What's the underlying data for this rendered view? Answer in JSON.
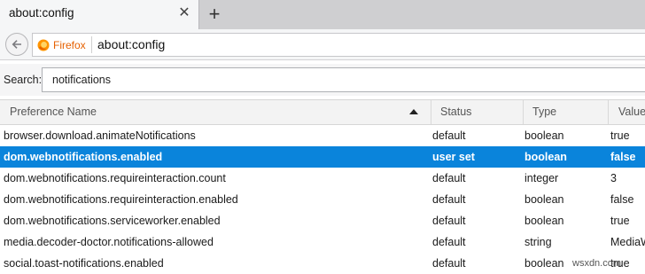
{
  "tab": {
    "title": "about:config",
    "close_glyph": "✕",
    "new_tab_glyph": "+"
  },
  "navbar": {
    "back_icon": "back-arrow-icon",
    "identity_label": "Firefox",
    "url": "about:config"
  },
  "search": {
    "label": "Search:",
    "value": "notifications"
  },
  "table": {
    "columns": [
      "Preference Name",
      "Status",
      "Type",
      "Value"
    ],
    "sort_column": "Preference Name",
    "sort_direction": "ascending",
    "rows": [
      {
        "name": "browser.download.animateNotifications",
        "status": "default",
        "type": "boolean",
        "value": "true",
        "selected": false
      },
      {
        "name": "dom.webnotifications.enabled",
        "status": "user set",
        "type": "boolean",
        "value": "false",
        "selected": true
      },
      {
        "name": "dom.webnotifications.requireinteraction.count",
        "status": "default",
        "type": "integer",
        "value": "3",
        "selected": false
      },
      {
        "name": "dom.webnotifications.requireinteraction.enabled",
        "status": "default",
        "type": "boolean",
        "value": "false",
        "selected": false
      },
      {
        "name": "dom.webnotifications.serviceworker.enabled",
        "status": "default",
        "type": "boolean",
        "value": "true",
        "selected": false
      },
      {
        "name": "media.decoder-doctor.notifications-allowed",
        "status": "default",
        "type": "string",
        "value": "MediaW",
        "selected": false
      },
      {
        "name": "social.toast-notifications.enabled",
        "status": "default",
        "type": "boolean",
        "value": "true",
        "selected": false
      }
    ]
  },
  "watermark": "wsxdn.com",
  "colors": {
    "selection": "#0a84db",
    "firefox_label": "#e66000"
  }
}
